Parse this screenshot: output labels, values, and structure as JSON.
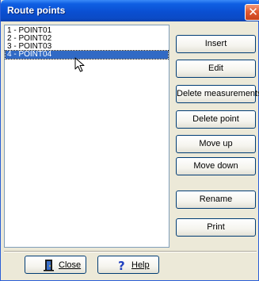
{
  "window": {
    "title": "Route points",
    "close_glyph": "✕"
  },
  "list": {
    "items": [
      {
        "label": "1 - POINT01",
        "selected": false
      },
      {
        "label": "2 - POINT02",
        "selected": false
      },
      {
        "label": "3 - POINT03",
        "selected": false
      },
      {
        "label": "4 - POINT04",
        "selected": true
      }
    ]
  },
  "side_buttons": {
    "insert": "Insert",
    "edit": "Edit",
    "delete_measurements": "Delete measurements",
    "delete_point": "Delete point",
    "move_up": "Move up",
    "move_down": "Move down",
    "rename": "Rename",
    "print": "Print"
  },
  "bottom_buttons": {
    "close": {
      "label": "Close",
      "icon": "door-exit-icon"
    },
    "help": {
      "label": "Help",
      "icon": "help-question-icon"
    }
  },
  "colors": {
    "titlebar": "#0a4fd2",
    "selection": "#316ac5",
    "face": "#ece9d8",
    "close_button": "#e05b33"
  }
}
